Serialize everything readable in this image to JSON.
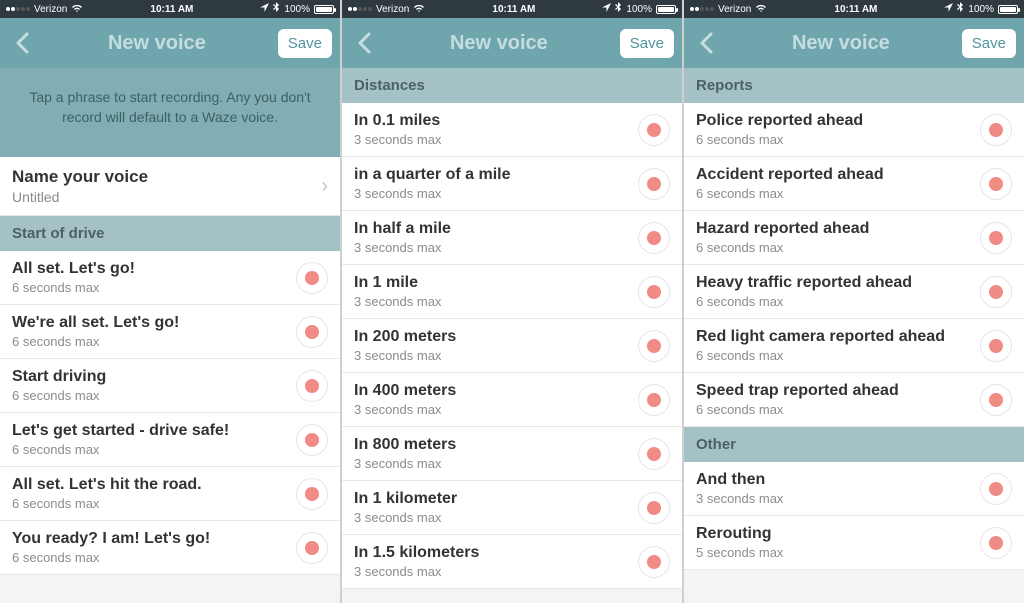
{
  "status": {
    "carrier": "Verizon",
    "time": "10:11 AM",
    "battery_pct": "100%"
  },
  "nav": {
    "title": "New voice",
    "save_label": "Save"
  },
  "screen1": {
    "instructions": "Tap a phrase to start recording. Any you don't record will default to a Waze voice.",
    "name_label": "Name your voice",
    "name_value": "Untitled",
    "section_start": "Start of drive",
    "items": [
      {
        "phrase": "All set. Let's go!",
        "limit": "6 seconds max"
      },
      {
        "phrase": "We're all set. Let's go!",
        "limit": "6 seconds max"
      },
      {
        "phrase": "Start driving",
        "limit": "6 seconds max"
      },
      {
        "phrase": "Let's get started - drive safe!",
        "limit": "6 seconds max"
      },
      {
        "phrase": "All set. Let's hit the road.",
        "limit": "6 seconds max"
      },
      {
        "phrase": "You ready? I am! Let's go!",
        "limit": "6 seconds max"
      }
    ]
  },
  "screen2": {
    "section_distances": "Distances",
    "items": [
      {
        "phrase": "In 0.1 miles",
        "limit": "3 seconds max"
      },
      {
        "phrase": "in a quarter of a mile",
        "limit": "3 seconds max"
      },
      {
        "phrase": "In half a mile",
        "limit": "3 seconds max"
      },
      {
        "phrase": "In 1 mile",
        "limit": "3 seconds max"
      },
      {
        "phrase": "In 200 meters",
        "limit": "3 seconds max"
      },
      {
        "phrase": "In 400 meters",
        "limit": "3 seconds max"
      },
      {
        "phrase": "In 800 meters",
        "limit": "3 seconds max"
      },
      {
        "phrase": "In 1 kilometer",
        "limit": "3 seconds max"
      },
      {
        "phrase": "In 1.5 kilometers",
        "limit": "3 seconds max"
      }
    ]
  },
  "screen3": {
    "section_reports": "Reports",
    "reports": [
      {
        "phrase": "Police reported ahead",
        "limit": "6 seconds max"
      },
      {
        "phrase": "Accident reported ahead",
        "limit": "6 seconds max"
      },
      {
        "phrase": "Hazard reported ahead",
        "limit": "6 seconds max"
      },
      {
        "phrase": "Heavy traffic reported ahead",
        "limit": "6 seconds max"
      },
      {
        "phrase": "Red light camera reported ahead",
        "limit": "6 seconds max"
      },
      {
        "phrase": "Speed trap reported ahead",
        "limit": "6 seconds max"
      }
    ],
    "section_other": "Other",
    "other": [
      {
        "phrase": "And then",
        "limit": "3 seconds max"
      },
      {
        "phrase": "Rerouting",
        "limit": "5 seconds max"
      }
    ]
  }
}
